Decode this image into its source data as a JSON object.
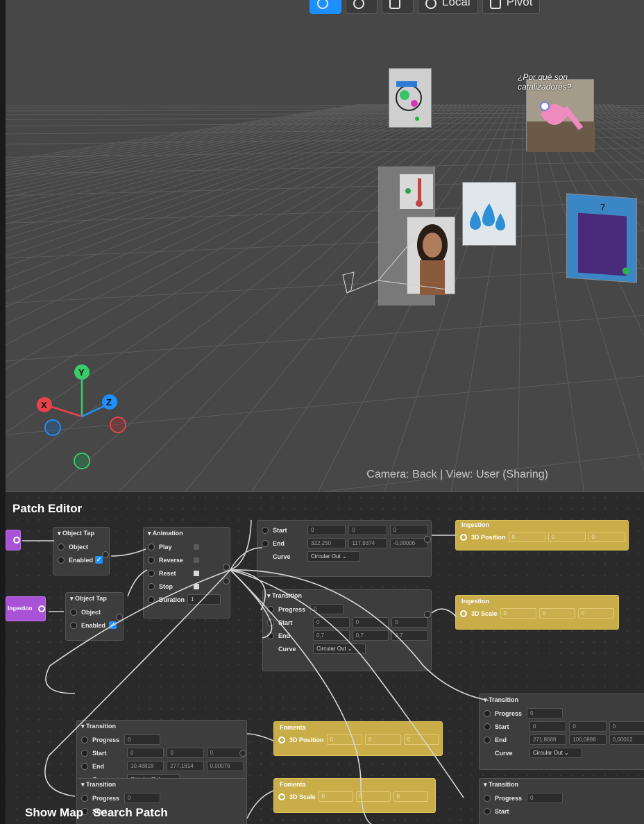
{
  "toolbar": {
    "move_label": "",
    "rotate_label": "",
    "scale_label": "",
    "local_label": "Local",
    "pivot_label": "Pivot"
  },
  "scene": {
    "card_spanish_text": "¿Por qué son catalizadores?",
    "card_number": "7",
    "camera_status": "Camera: Back | View: User (Sharing)",
    "axes": {
      "x": "X",
      "y": "Y",
      "z": "Z"
    }
  },
  "patch_editor": {
    "title": "Patch Editor",
    "show_map": "Show Map",
    "search_patch": "Search Patch",
    "left_patch_label": "Ingestion",
    "object_tap_1": {
      "title": "Object Tap",
      "object": "Object",
      "enabled": "Enabled"
    },
    "object_tap_2": {
      "title": "Object Tap",
      "object": "Object",
      "enabled": "Enabled"
    },
    "animation": {
      "title": "Animation",
      "play": "Play",
      "reverse": "Reverse",
      "reset": "Reset",
      "stop": "Stop",
      "duration": "Duration",
      "duration_value": "1"
    },
    "transition_top": {
      "start": "Start",
      "end": "End",
      "curve": "Curve",
      "start_vals": [
        "0",
        "0",
        "0"
      ],
      "end_vals": [
        "322,250",
        "117,9374",
        "-0,00006"
      ],
      "curve_value": "Circular Out"
    },
    "transition_mid": {
      "title": "Transition",
      "progress": "Progress",
      "progress_value": "0",
      "start": "Start",
      "end": "End",
      "curve": "Curve",
      "start_vals": [
        "0",
        "0",
        "0"
      ],
      "end_vals": [
        "0,7",
        "0,7",
        "0,7"
      ],
      "curve_value": "Circular Out"
    },
    "transition_left": {
      "title": "Transition",
      "progress": "Progress",
      "progress_value": "0",
      "start": "Start",
      "end": "End",
      "curve": "Curve",
      "start_vals": [
        "0",
        "0",
        "0"
      ],
      "end_vals": [
        "10,48818",
        "277,1614",
        "0,00076"
      ],
      "curve_value": "Circular Out"
    },
    "transition_right": {
      "title": "Transition",
      "progress": "Progress",
      "progress_value": "0",
      "start": "Start",
      "end": "End",
      "curve": "Curve",
      "start_vals": [
        "0",
        "0",
        "0"
      ],
      "end_vals": [
        "271,8688",
        "100,0898",
        "0,00012"
      ],
      "curve_value": "Circular Out"
    },
    "transition_bottom_left": {
      "title": "Transition",
      "progress": "Progress",
      "progress_value": "0",
      "start": "Start"
    },
    "transition_bottom_right": {
      "title": "Transition",
      "progress": "Progress",
      "progress_value": "0",
      "start": "Start"
    },
    "ingestion_pos": {
      "title": "Ingestion",
      "prop": "3D Position",
      "vals": [
        "0",
        "0",
        "0"
      ]
    },
    "ingestion_scale": {
      "title": "Ingestion",
      "prop": "3D Scale",
      "vals": [
        "0",
        "0",
        "0"
      ]
    },
    "fomenta_pos": {
      "title": "Fomenta",
      "prop": "3D Position",
      "vals": [
        "0",
        "0",
        "0"
      ]
    },
    "fomenta_scale": {
      "title": "Fomenta",
      "prop": "3D Scale",
      "vals": [
        "0",
        "0",
        "0"
      ]
    }
  },
  "colors": {
    "accent": "#1e8fff",
    "patch_yellow": "#c9ad48",
    "patch_purple": "#a952d6",
    "axis_x": "#e8424a",
    "axis_y": "#39cc6b",
    "axis_z": "#1e8fff"
  }
}
